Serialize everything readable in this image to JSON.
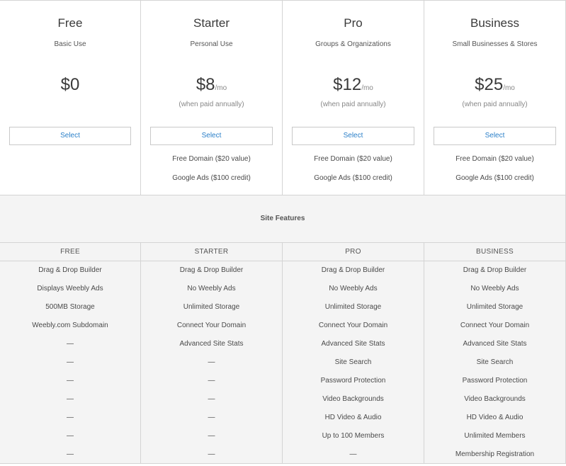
{
  "plans": [
    {
      "name": "Free",
      "description": "Basic Use",
      "price": "$0",
      "unit": "",
      "billing": "",
      "select_label": "Select",
      "perks": [
        "",
        ""
      ]
    },
    {
      "name": "Starter",
      "description": "Personal Use",
      "price": "$8",
      "unit": "/mo",
      "billing": "(when paid annually)",
      "select_label": "Select",
      "perks": [
        "Free Domain ($20 value)",
        "Google Ads ($100 credit)"
      ]
    },
    {
      "name": "Pro",
      "description": "Groups & Organizations",
      "price": "$12",
      "unit": "/mo",
      "billing": "(when paid annually)",
      "select_label": "Select",
      "perks": [
        "Free Domain ($20 value)",
        "Google Ads ($100 credit)"
      ]
    },
    {
      "name": "Business",
      "description": "Small Businesses & Stores",
      "price": "$25",
      "unit": "/mo",
      "billing": "(when paid annually)",
      "select_label": "Select",
      "perks": [
        "Free Domain ($20 value)",
        "Google Ads ($100 credit)"
      ]
    }
  ],
  "features_section": {
    "title": "Site Features"
  },
  "feature_columns": [
    {
      "header": "FREE",
      "items": [
        "Drag & Drop Builder",
        "Displays Weebly Ads",
        "500MB Storage",
        "Weebly.com Subdomain",
        "—",
        "—",
        "—",
        "—",
        "—",
        "—",
        "—"
      ]
    },
    {
      "header": "STARTER",
      "items": [
        "Drag & Drop Builder",
        "No Weebly Ads",
        "Unlimited Storage",
        "Connect Your Domain",
        "Advanced Site Stats",
        "—",
        "—",
        "—",
        "—",
        "—",
        "—"
      ]
    },
    {
      "header": "PRO",
      "items": [
        "Drag & Drop Builder",
        "No Weebly Ads",
        "Unlimited Storage",
        "Connect Your Domain",
        "Advanced Site Stats",
        "Site Search",
        "Password Protection",
        "Video Backgrounds",
        "HD Video & Audio",
        "Up to 100 Members",
        "—"
      ]
    },
    {
      "header": "BUSINESS",
      "items": [
        "Drag & Drop Builder",
        "No Weebly Ads",
        "Unlimited Storage",
        "Connect Your Domain",
        "Advanced Site Stats",
        "Site Search",
        "Password Protection",
        "Video Backgrounds",
        "HD Video & Audio",
        "Unlimited Members",
        "Membership Registration"
      ]
    }
  ]
}
